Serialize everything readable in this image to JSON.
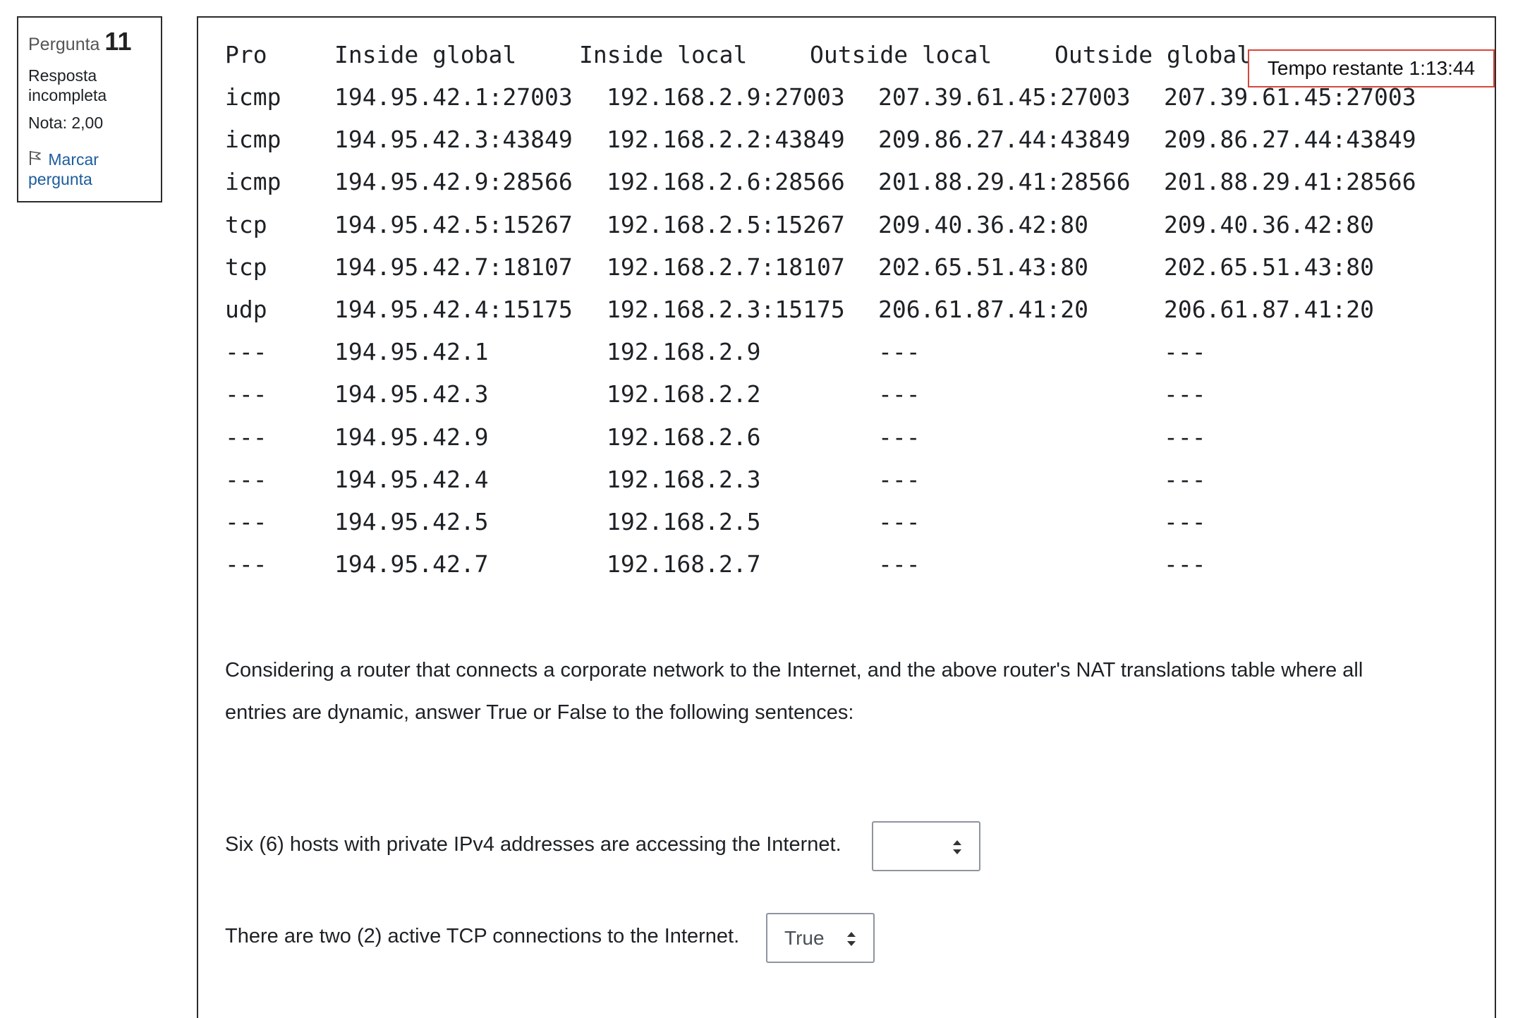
{
  "question_info": {
    "label": "Pergunta",
    "number": "11",
    "state": "Resposta incompleta",
    "grade": "Nota: 2,00",
    "flag_label": "Marcar pergunta"
  },
  "timer": "Tempo restante 1:13:44",
  "nat_table": {
    "headers": [
      "Pro",
      "Inside global",
      "Inside local",
      "Outside local",
      "Outside global"
    ],
    "rows": [
      [
        "icmp",
        "194.95.42.1:27003",
        "192.168.2.9:27003",
        "207.39.61.45:27003",
        "207.39.61.45:27003"
      ],
      [
        "icmp",
        "194.95.42.3:43849",
        "192.168.2.2:43849",
        "209.86.27.44:43849",
        "209.86.27.44:43849"
      ],
      [
        "icmp",
        "194.95.42.9:28566",
        "192.168.2.6:28566",
        "201.88.29.41:28566",
        "201.88.29.41:28566"
      ],
      [
        "tcp",
        "194.95.42.5:15267",
        "192.168.2.5:15267",
        "209.40.36.42:80",
        "209.40.36.42:80"
      ],
      [
        "tcp",
        "194.95.42.7:18107",
        "192.168.2.7:18107",
        "202.65.51.43:80",
        "202.65.51.43:80"
      ],
      [
        "udp",
        "194.95.42.4:15175",
        "192.168.2.3:15175",
        "206.61.87.41:20",
        "206.61.87.41:20"
      ],
      [
        "---",
        "194.95.42.1",
        "192.168.2.9",
        "---",
        "---"
      ],
      [
        "---",
        "194.95.42.3",
        "192.168.2.2",
        "---",
        "---"
      ],
      [
        "---",
        "194.95.42.9",
        "192.168.2.6",
        "---",
        "---"
      ],
      [
        "---",
        "194.95.42.4",
        "192.168.2.3",
        "---",
        "---"
      ],
      [
        "---",
        "194.95.42.5",
        "192.168.2.5",
        "---",
        "---"
      ],
      [
        "---",
        "194.95.42.7",
        "192.168.2.7",
        "---",
        "---"
      ]
    ]
  },
  "question_text": "Considering a router that connects a corporate network to the Internet, and the above router's NAT translations table where all entries are dynamic, answer True or False to the following sentences:",
  "sentences": [
    {
      "text": "Six (6) hosts with private IPv4 addresses are accessing the Internet.",
      "selected": ""
    },
    {
      "text": "There are two (2) active TCP connections to the Internet.",
      "selected": "True"
    }
  ],
  "icons": {
    "flag": "flag-icon",
    "select": "chevron-up-down-icon"
  },
  "colors": {
    "link": "#1c5c9c",
    "timer_border": "#d9453b",
    "border": "#2b2b2b"
  }
}
